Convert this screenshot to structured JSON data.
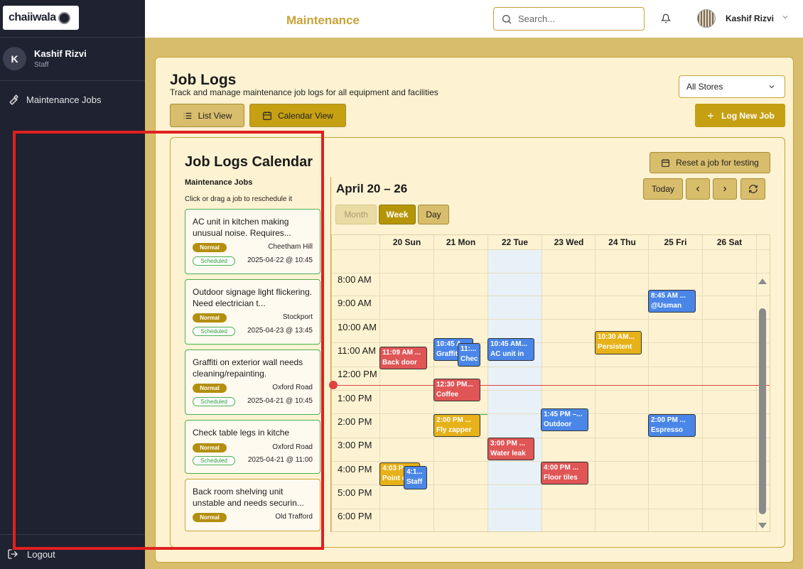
{
  "sidebar": {
    "logo_text": "chaiiwala",
    "user_initial": "K",
    "user_name": "Kashif Rizvi",
    "user_role": "Staff",
    "nav_item": "Maintenance Jobs",
    "logout": "Logout"
  },
  "topbar": {
    "title": "Maintenance",
    "search_placeholder": "Search...",
    "user_name": "Kashif Rizvi"
  },
  "page": {
    "title": "Job Logs",
    "subtitle": "Track and manage maintenance job logs for all equipment and facilities",
    "store_filter": "All Stores",
    "list_view": "List View",
    "calendar_view": "Calendar View",
    "log_new_job": "Log New Job"
  },
  "calendar_panel": {
    "title": "Job Logs Calendar",
    "jobs_heading": "Maintenance Jobs",
    "hint": "Click or drag a job to reschedule it",
    "reset_button": "Reset a job for testing",
    "range": "April 20 – 26",
    "today": "Today",
    "prev": "‹",
    "next": "›",
    "views": [
      "Month",
      "Week",
      "Day"
    ],
    "days": [
      "20 Sun",
      "21 Mon",
      "22 Tue",
      "23 Wed",
      "24 Thu",
      "25 Fri",
      "26 Sat"
    ],
    "times": [
      "8:00 AM",
      "9:00 AM",
      "10:00 AM",
      "11:00 AM",
      "12:00 PM",
      "1:00 PM",
      "2:00 PM",
      "3:00 PM",
      "4:00 PM",
      "5:00 PM",
      "6:00 PM"
    ]
  },
  "jobs": [
    {
      "desc": "AC unit in kitchen making unusual noise. Requires...",
      "priority": "Normal",
      "location": "Cheetham Hill",
      "status": "Scheduled",
      "date": "2025-04-22 @ 10:45"
    },
    {
      "desc": "Outdoor signage light flickering. Need electrician t...",
      "priority": "Normal",
      "location": "Stockport",
      "status": "Scheduled",
      "date": "2025-04-23 @ 13:45"
    },
    {
      "desc": "Graffiti on exterior wall needs cleaning/repainting.",
      "priority": "Normal",
      "location": "Oxford Road",
      "status": "Scheduled",
      "date": "2025-04-21 @ 10:45"
    },
    {
      "desc": "Check table legs in kitche",
      "priority": "Normal",
      "location": "Oxford Road",
      "status": "Scheduled",
      "date": "2025-04-21 @ 11:00"
    },
    {
      "desc": "Back room shelving unit unstable and needs securin...",
      "priority": "Normal",
      "location": "Old Trafford",
      "status": "",
      "date": ""
    }
  ],
  "events": [
    {
      "time": "11:09 AM ...",
      "title": "Back door",
      "color": "#e05555"
    },
    {
      "time": "10:45 A...",
      "title": "Graffiti",
      "color": "#4a86e8"
    },
    {
      "time": "11:...",
      "title": "Chec",
      "color": "#4a86e8"
    },
    {
      "time": "10:45 AM...",
      "title": "AC unit in",
      "color": "#4a86e8"
    },
    {
      "time": "10:30 AM...",
      "title": "Persistent",
      "color": "#e7b219"
    },
    {
      "time": "8:45 AM ...",
      "title": "@Usman",
      "color": "#4a86e8"
    },
    {
      "time": "12:30 PM...",
      "title": "Coffee",
      "color": "#e05555"
    },
    {
      "time": "2:00 PM ...",
      "title": "Fly zapper",
      "color": "#e7b219"
    },
    {
      "time": "1:45 PM –...",
      "title": "Outdoor",
      "color": "#4a86e8"
    },
    {
      "time": "2:00 PM ...",
      "title": "Espresso",
      "color": "#4a86e8"
    },
    {
      "time": "3:00 PM ...",
      "title": "Water leak",
      "color": "#e05555"
    },
    {
      "time": "4:00 PM ...",
      "title": "Floor tiles",
      "color": "#e05555"
    },
    {
      "time": "4:03 P",
      "title": "Point o",
      "color": "#e7b219"
    },
    {
      "time": "4:1...",
      "title": "Staff",
      "color": "#4a86e8"
    }
  ],
  "colors": {
    "accent": "#c5a012",
    "sidebar_bg": "#1f2230",
    "page_bg": "#d8bd6c",
    "panel_bg": "#fdf3d2",
    "highlight": "#e02020"
  }
}
